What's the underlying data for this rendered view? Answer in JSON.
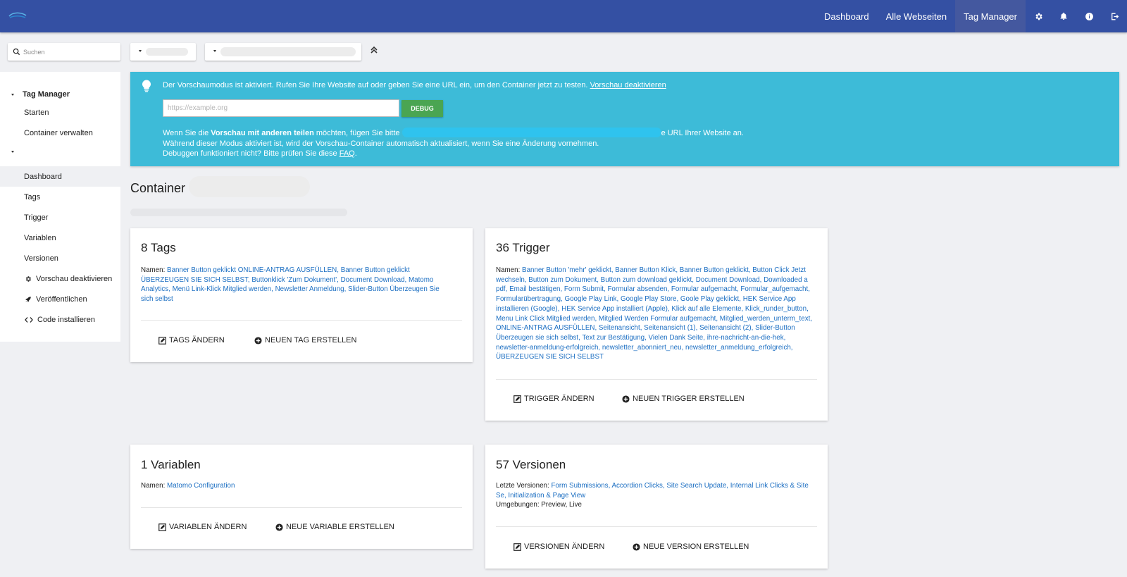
{
  "topbar": {
    "nav": [
      {
        "label": "Dashboard",
        "active": false
      },
      {
        "label": "Alle Webseiten",
        "active": false
      },
      {
        "label": "Tag Manager",
        "active": true
      }
    ],
    "icons": [
      "gear-icon",
      "bell-icon",
      "info-icon",
      "logout-icon"
    ]
  },
  "search": {
    "placeholder": "Suchen"
  },
  "sidebar": {
    "group1": "Tag Manager",
    "group1_items": [
      "Starten",
      "Container verwalten"
    ],
    "group2_items": [
      {
        "label": "Dashboard",
        "active": true
      },
      {
        "label": "Tags"
      },
      {
        "label": "Trigger"
      },
      {
        "label": "Variablen"
      },
      {
        "label": "Versionen"
      },
      {
        "label": "Vorschau deaktivieren",
        "icon": "gear-icon"
      },
      {
        "label": "Veröffentlichen",
        "icon": "rocket-icon"
      },
      {
        "label": "Code installieren",
        "icon": "code-icon"
      }
    ]
  },
  "notice": {
    "text1": "Der Vorschaumodus ist aktiviert. Rufen Sie Ihre Website auf oder geben Sie eine URL ein, um den Container jetzt zu testen.",
    "link1": "Vorschau deaktivieren",
    "url_placeholder": "https://example.org",
    "debug_label": "DEBUG",
    "share_pre": "Wenn Sie die ",
    "share_bold": "Vorschau mit anderen teilen",
    "share_mid": " möchten, fügen Sie bitte",
    "share_post": "e URL Ihrer Website an.",
    "line3": "Während dieser Modus aktiviert ist, wird der Vorschau-Container automatisch aktualisiert, wenn Sie eine Änderung vornehmen.",
    "line4_pre": "Debuggen funktioniert nicht? Bitte prüfen Sie diese ",
    "line4_link": "FAQ",
    "line4_post": "."
  },
  "container": {
    "title": "Container"
  },
  "cards": {
    "tags": {
      "title": "8 Tags",
      "names_label": "Namen:",
      "names": "Banner Button geklickt ONLINE-ANTRAG AUSFÜLLEN, Banner Button geklickt ÜBERZEUGEN SIE SICH SELBST, Buttonklick 'Zum Dokument', Document Download, Matomo Analytics, Menü Link-Klick Mitglied werden, Newsletter Anmeldung, Slider-Button Überzeugen Sie sich selbst",
      "action_edit": "Tags ändern",
      "action_new": "Neuen Tag erstellen"
    },
    "trigger": {
      "title": "36 Trigger",
      "names_label": "Namen:",
      "names": "Banner Button 'mehr' geklickt, Banner Button Klick, Banner Button geklickt, Button Click Jetzt wechseln, Button zum Dokument, Button zum download geklickt, Document Download, Downloaded a pdf, Email bestätigen, Form Submit, Formular absenden, Formular aufgemacht, Formular_aufgemacht, Formularübertragung, Google Play Link, Google Play Store, Goole Play geklickt, HEK Service App installieren (Google), HEK Service App installiert (Apple), Klick auf alle Elemente, Klick_runder_button, Menu Link Click Mitglied werden, Mitglied Werden Formular aufgemacht, Mitglied_werden_unterm_text, ONLINE-ANTRAG AUSFÜLLEN, Seitenansicht, Seitenansicht (1), Seitenansicht (2), Slider-Button Überzeugen sie sich selbst, Text zur Bestätigung, Vielen Dank Seite, ihre-nachricht-an-die-hek, newsletter-anmeldung-erfolgreich, newsletter_abonniert_neu, newsletter_anmeldung_erfolgreich, ÜBERZEUGEN SIE SICH SELBST",
      "action_edit": "Trigger ändern",
      "action_new": "Neuen Trigger erstellen"
    },
    "variablen": {
      "title": "1 Variablen",
      "names_label": "Namen:",
      "names": "Matomo Configuration",
      "action_edit": "Variablen ändern",
      "action_new": "Neue Variable erstellen"
    },
    "versionen": {
      "title": "57 Versionen",
      "last_label": "Letzte Versionen:",
      "last": "Form Submissions, Accordion Clicks, Site Search Update, Internal Link Clicks & Site Se, Initialization & Page View",
      "env_line": "Umgebungen: Preview, Live",
      "action_edit": "Versionen ändern",
      "action_new": "Neue Version erstellen"
    }
  }
}
